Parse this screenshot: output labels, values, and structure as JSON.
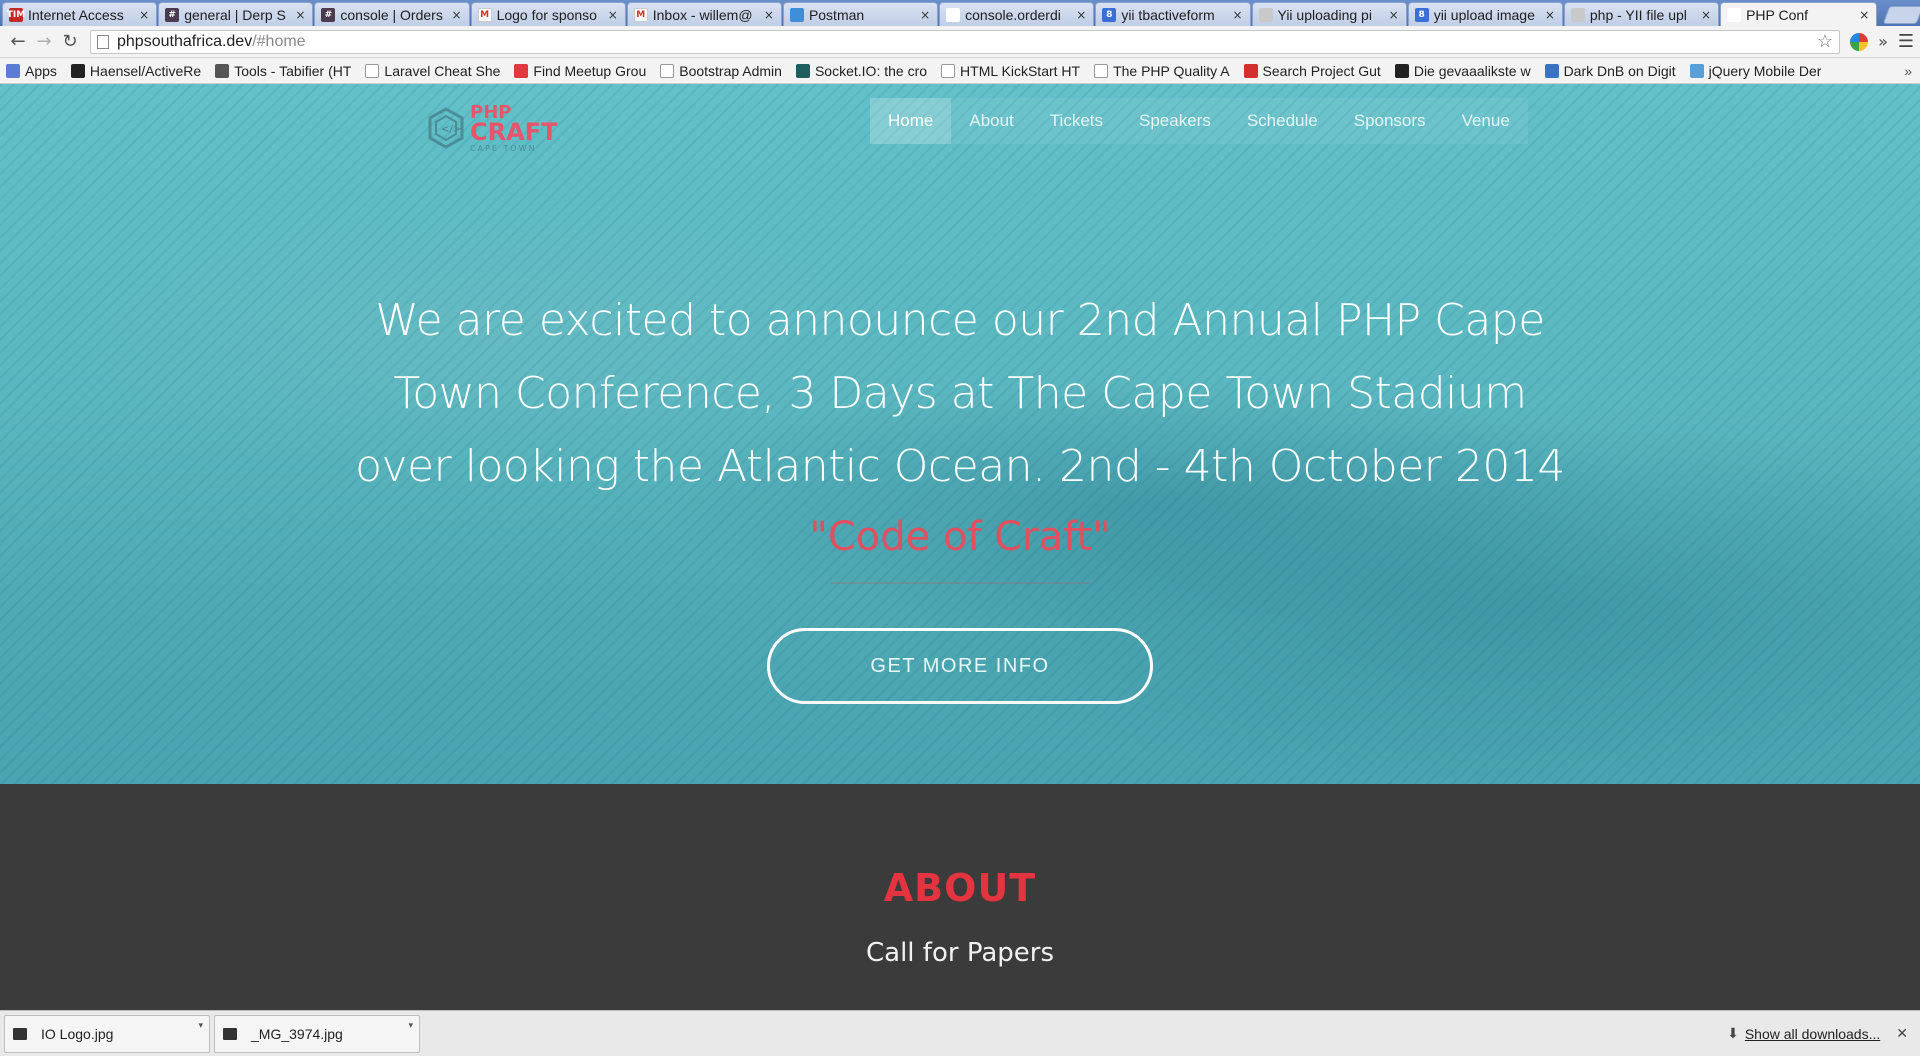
{
  "browser": {
    "tabs": [
      {
        "title": "Internet Access",
        "favicon_color": "#c62828",
        "favicon_text": "TIM"
      },
      {
        "title": "general | Derp S",
        "favicon_color": "#4a3b4f",
        "favicon_text": "#"
      },
      {
        "title": "console | Orders",
        "favicon_color": "#4a3b4f",
        "favicon_text": "#"
      },
      {
        "title": "Logo for sponso",
        "favicon_color": "#ffffff",
        "favicon_text": "M"
      },
      {
        "title": "Inbox - willem@",
        "favicon_color": "#ffffff",
        "favicon_text": "M"
      },
      {
        "title": "Postman",
        "favicon_color": "#3f8fd8",
        "favicon_text": ""
      },
      {
        "title": "console.orderdi",
        "favicon_color": "#ffffff",
        "favicon_text": ""
      },
      {
        "title": "yii tbactiveform",
        "favicon_color": "#3b6fd8",
        "favicon_text": "8"
      },
      {
        "title": "Yii uploading pi",
        "favicon_color": "#c9c9c9",
        "favicon_text": ""
      },
      {
        "title": "yii upload image",
        "favicon_color": "#3b6fd8",
        "favicon_text": "8"
      },
      {
        "title": "php - YII file upl",
        "favicon_color": "#c9c9c9",
        "favicon_text": ""
      },
      {
        "title": "PHP Conf",
        "favicon_color": "#ffffff",
        "favicon_text": "",
        "active": true
      }
    ],
    "url": {
      "host": "phpsouthafrica.dev",
      "path": "/#home"
    },
    "bookmarks": [
      {
        "label": "Apps",
        "icon_color": "#5b7bd5"
      },
      {
        "label": "Haensel/ActiveRe",
        "icon_color": "#222222"
      },
      {
        "label": "Tools - Tabifier (HT",
        "icon_color": "#555555"
      },
      {
        "label": "Laravel Cheat She",
        "icon_color": "#dddddd"
      },
      {
        "label": "Find Meetup Grou",
        "icon_color": "#e0393e"
      },
      {
        "label": "Bootstrap Admin",
        "icon_color": "#dddddd"
      },
      {
        "label": "Socket.IO: the cro",
        "icon_color": "#1e5e5e"
      },
      {
        "label": "HTML KickStart HT",
        "icon_color": "#dddddd"
      },
      {
        "label": "The PHP Quality A",
        "icon_color": "#dddddd"
      },
      {
        "label": "Search Project Gut",
        "icon_color": "#d32f2f"
      },
      {
        "label": "Die gevaaalikste w",
        "icon_color": "#222222"
      },
      {
        "label": "Dark DnB on Digit",
        "icon_color": "#3a72c4"
      },
      {
        "label": "jQuery Mobile Der",
        "icon_color": "#5aa0d8"
      }
    ],
    "bookmarks_more": "»"
  },
  "site": {
    "logo": {
      "line1": "PHP",
      "line2": "CRAFT",
      "line3": "CAPE TOWN"
    },
    "nav": [
      {
        "label": "Home",
        "active": true
      },
      {
        "label": "About"
      },
      {
        "label": "Tickets"
      },
      {
        "label": "Speakers"
      },
      {
        "label": "Schedule"
      },
      {
        "label": "Sponsors"
      },
      {
        "label": "Venue"
      }
    ],
    "hero": {
      "headline": "We are excited to announce our 2nd Annual PHP Cape Town Conference, 3 Days at The Cape Town Stadium over looking the Atlantic Ocean. 2nd - 4th October 2014",
      "tagline": "\"Code of Craft\"",
      "cta": "GET MORE INFO"
    },
    "about": {
      "title": "ABOUT",
      "subtitle": "Call for Papers"
    }
  },
  "downloads": {
    "items": [
      {
        "name": "IO Logo.jpg"
      },
      {
        "name": "_MG_3974.jpg"
      }
    ],
    "show_all": "Show all downloads..."
  },
  "colors": {
    "accent_red": "#e3343f",
    "hero_teal": "#5ab6bf",
    "section_dark": "#3b3b3b"
  }
}
